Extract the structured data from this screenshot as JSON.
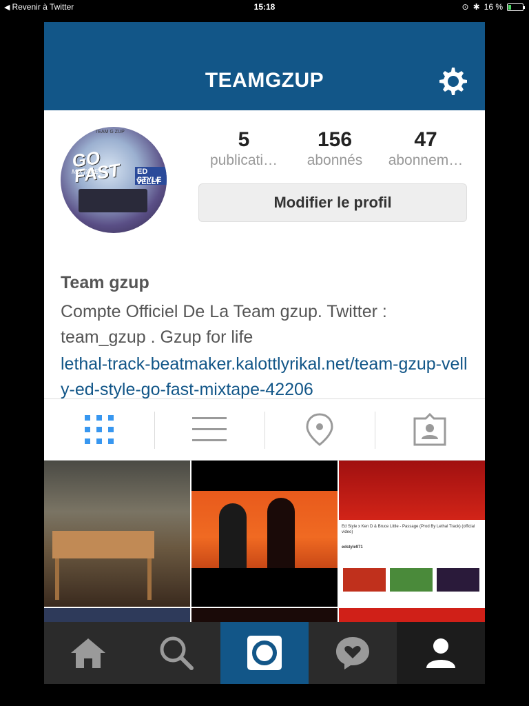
{
  "status_bar": {
    "back_label": "Revenir à Twitter",
    "time": "15:18",
    "battery": "16 %",
    "battery_level": 0.16
  },
  "header": {
    "title": "TEAMGZUP",
    "settings_icon": "gear-icon"
  },
  "profile": {
    "avatar_text": {
      "line1": "GO",
      "line2": "FAST",
      "mixtape": "MIXTAPE",
      "artist1": "ED STYLE",
      "artist2": "VELLY",
      "brand": "TEAM G ZUP"
    },
    "stats": [
      {
        "value": "5",
        "label": "publicati…"
      },
      {
        "value": "156",
        "label": "abonnés"
      },
      {
        "value": "47",
        "label": "abonnem…"
      }
    ],
    "edit_button": "Modifier le profil",
    "name": "Team gzup",
    "bio": "Compte Officiel De La Team gzup. Twitter : team_gzup . Gzup for life",
    "link": "lethal-track-beatmaker.kalottlyrikal.net/team-gzup-velly-ed-style-go-fast-mixtape-42206"
  },
  "view_tabs": [
    {
      "icon": "grid-icon",
      "active": true
    },
    {
      "icon": "list-icon",
      "active": false
    },
    {
      "icon": "location-pin-icon",
      "active": false
    },
    {
      "icon": "tagged-person-icon",
      "active": false
    }
  ],
  "posts": {
    "third_post_title": "Ed Style x Ken D & Bruce Little - Passage (Prod By Lethal Track) (official video)",
    "third_post_channel": "edstyle971"
  },
  "bottom_nav": [
    {
      "icon": "home-icon"
    },
    {
      "icon": "search-icon"
    },
    {
      "icon": "camera-icon",
      "active": true
    },
    {
      "icon": "activity-heart-icon"
    },
    {
      "icon": "profile-icon"
    }
  ],
  "colors": {
    "brand_blue": "#125688",
    "nav_dark": "#2b2b2b",
    "tab_active": "#3897f0"
  }
}
